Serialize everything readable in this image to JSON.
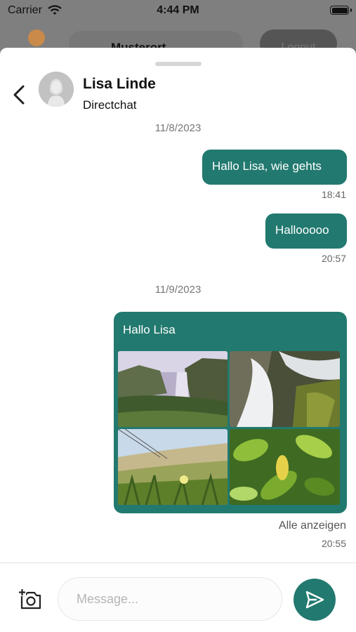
{
  "status_bar": {
    "carrier": "Carrier",
    "time": "4:44 PM"
  },
  "background_screen": {
    "title": "Musterort",
    "button_label": "Logout"
  },
  "header": {
    "name": "Lisa Linde",
    "subtitle": "Directchat"
  },
  "messages": [
    {
      "date": "11/8/2023"
    },
    {
      "text": "Hallo Lisa, wie gehts",
      "time": "18:41"
    },
    {
      "text": "Hallooooo",
      "time": "20:57"
    },
    {
      "date": "11/9/2023"
    },
    {
      "text": "Hallo Lisa",
      "images": [
        "waterfall-image",
        "stream-image",
        "dune-grass-image",
        "leaves-image"
      ],
      "link": "Alle anzeigen",
      "time": "20:55"
    }
  ],
  "composer": {
    "placeholder": "Message..."
  },
  "colors": {
    "accent": "#22796f"
  }
}
